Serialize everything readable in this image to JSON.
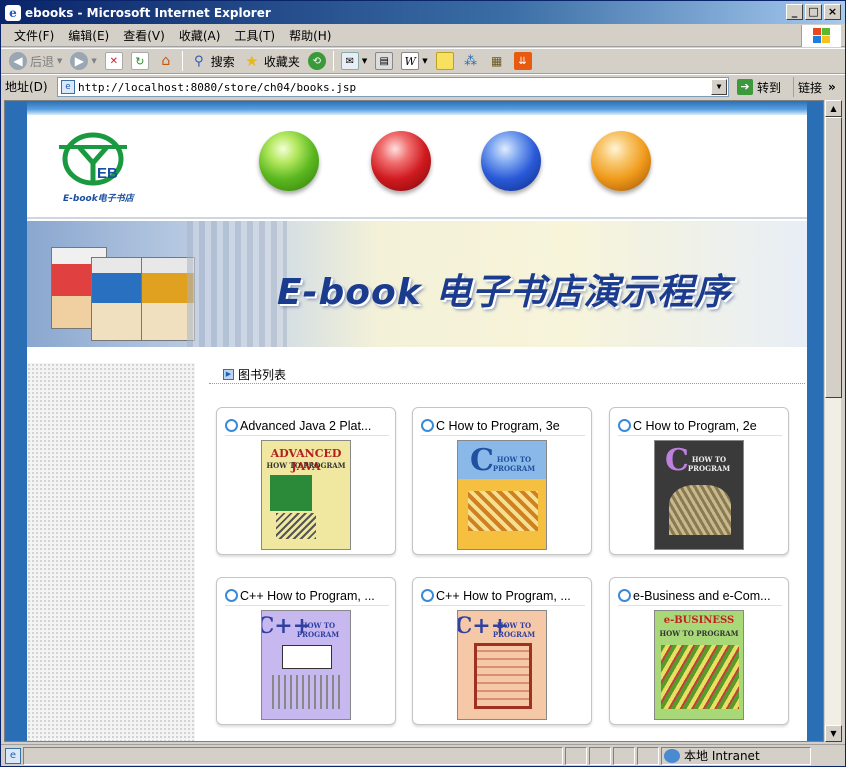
{
  "window": {
    "title": "ebooks - Microsoft Internet Explorer",
    "minimize": "_",
    "maximize": "□",
    "close": "×"
  },
  "menu": [
    "文件(F)",
    "编辑(E)",
    "查看(V)",
    "收藏(A)",
    "工具(T)",
    "帮助(H)"
  ],
  "toolbar": {
    "back": "后退",
    "search": "搜索",
    "favorites": "收藏夹"
  },
  "address": {
    "label": "地址(D)",
    "url": "http://localhost:8080/store/ch04/books.jsp",
    "go": "转到",
    "links": "链接"
  },
  "status": {
    "zone": "本地 Intranet"
  },
  "site": {
    "logo_text": "EB",
    "logo_caption": "E-book电子书店",
    "banner_title": "E-book 电子书店演示程序",
    "section_title": "图书列表",
    "orb_colors": [
      "#6cc22a",
      "#e0202a",
      "#2a5ad8",
      "#f09a1a"
    ]
  },
  "books": [
    {
      "title": "Advanced Java 2 Plat...",
      "cover_title": "ADVANCED JAVA",
      "cover_sub": "HOW TO PROGRAM",
      "cover_bg": "#f0e8a0",
      "cover_fg": "#b02020"
    },
    {
      "title": "C How to Program, 3e",
      "cover_title": "C",
      "cover_sub": "HOW TO PROGRAM",
      "cover_bg": "#f5c040",
      "cover_fg": "#2050a0"
    },
    {
      "title": "C How to Program, 2e",
      "cover_title": "C",
      "cover_sub": "HOW TO PROGRAM",
      "cover_bg": "#3a3a3a",
      "cover_fg": "#c080e0"
    },
    {
      "title": "C++ How to Program, ...",
      "cover_title": "C++",
      "cover_sub": "HOW TO PROGRAM",
      "cover_bg": "#c8b8f0",
      "cover_fg": "#3040a0"
    },
    {
      "title": "C++ How to Program, ...",
      "cover_title": "C++",
      "cover_sub": "HOW TO PROGRAM",
      "cover_bg": "#f5c8a8",
      "cover_fg": "#a03020"
    },
    {
      "title": "e-Business and e-Com...",
      "cover_title": "e-BUSINESS",
      "cover_sub": "HOW TO PROGRAM",
      "cover_bg": "#a8d878",
      "cover_fg": "#c02020"
    }
  ]
}
